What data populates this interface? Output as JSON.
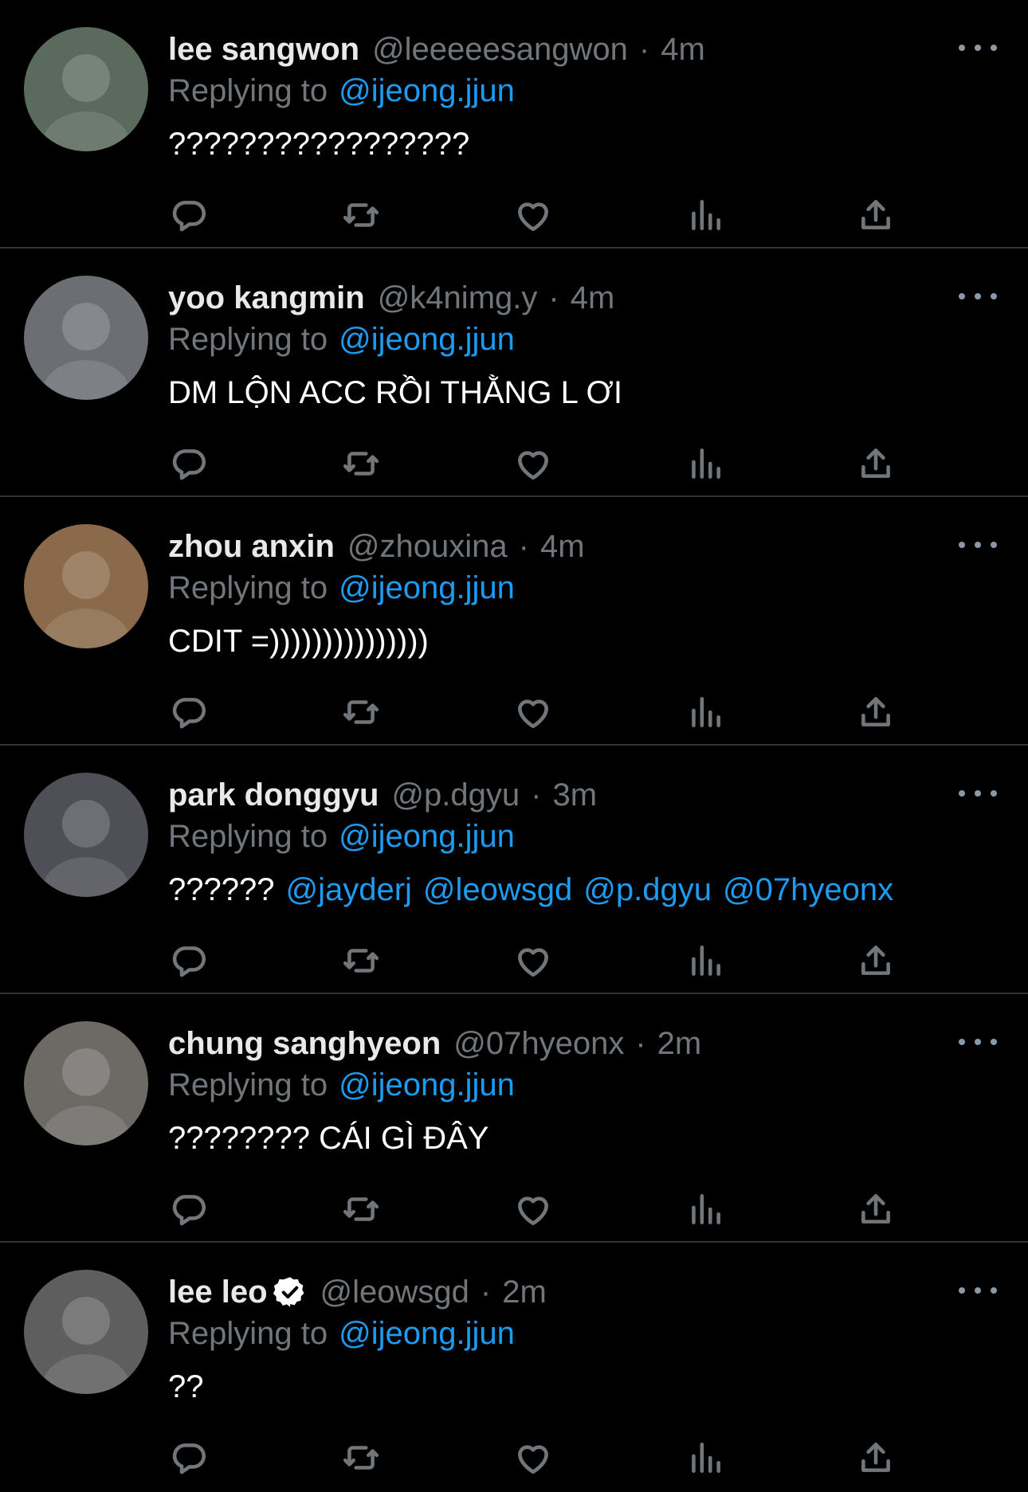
{
  "colors": {
    "background": "#000000",
    "text": "#e7e9ea",
    "muted": "#71767b",
    "link": "#1d9bf0",
    "divider": "#2f3336"
  },
  "icons": {
    "more": "more-horizontal-icon",
    "reply": "reply-icon",
    "retweet": "retweet-icon",
    "like": "heart-icon",
    "views": "views-icon",
    "share": "share-icon",
    "verified": "verified-badge-icon"
  },
  "tweets": [
    {
      "name": "lee sangwon",
      "handle": "@leeeeesangwon",
      "separator": "·",
      "time": "4m",
      "reply_prefix": "Replying to",
      "reply_to": "@ijeong.jjun",
      "text": "?????????????????",
      "mentions": [],
      "verified": false,
      "avatar_color": "#5a6a5c"
    },
    {
      "name": "yoo kangmin",
      "handle": "@k4nimg.y",
      "separator": "·",
      "time": "4m",
      "reply_prefix": "Replying to",
      "reply_to": "@ijeong.jjun",
      "text": "DM LỘN ACC RỒI THẰNG L ƠI",
      "mentions": [],
      "verified": false,
      "avatar_color": "#6b6f74"
    },
    {
      "name": "zhou anxin",
      "handle": "@zhouxina",
      "separator": "·",
      "time": "4m",
      "reply_prefix": "Replying to",
      "reply_to": "@ijeong.jjun",
      "text": "CDIT =)))))))))))))))",
      "mentions": [],
      "verified": false,
      "avatar_color": "#8a6a4a"
    },
    {
      "name": "park donggyu",
      "handle": "@p.dgyu",
      "separator": "·",
      "time": "3m",
      "reply_prefix": "Replying to",
      "reply_to": "@ijeong.jjun",
      "text": "??????",
      "mentions": [
        "@jayderj",
        "@leowsgd",
        "@p.dgyu",
        "@07hyeonx"
      ],
      "verified": false,
      "avatar_color": "#4f4f57"
    },
    {
      "name": "chung sanghyeon",
      "handle": "@07hyeonx",
      "separator": "·",
      "time": "2m",
      "reply_prefix": "Replying to",
      "reply_to": "@ijeong.jjun",
      "text": "???????? CÁI GÌ ĐÂY",
      "mentions": [],
      "verified": false,
      "avatar_color": "#6d6a66"
    },
    {
      "name": "lee leo",
      "handle": "@leowsgd",
      "separator": "·",
      "time": "2m",
      "reply_prefix": "Replying to",
      "reply_to": "@ijeong.jjun",
      "text": "??",
      "mentions": [],
      "verified": true,
      "avatar_color": "#5e5e5e"
    }
  ]
}
